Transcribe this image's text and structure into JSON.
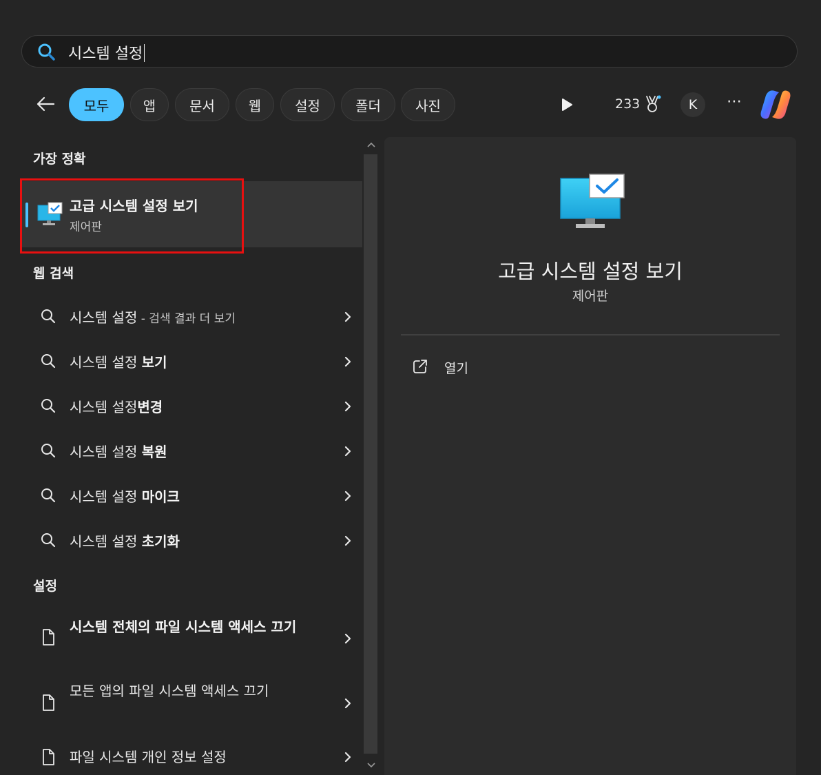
{
  "search": {
    "query": "시스템 설정"
  },
  "filters": [
    "모두",
    "앱",
    "문서",
    "웹",
    "설정",
    "폴더",
    "사진"
  ],
  "header": {
    "points": "233",
    "avatar_initial": "K"
  },
  "best_match": {
    "section_label": "가장 정확",
    "title": "고급 시스템 설정 보기",
    "subtitle": "제어판"
  },
  "web_search": {
    "section_label": "웹 검색",
    "items": [
      {
        "prefix": "시스템 설정",
        "bold": "",
        "suffix": " - 검색 결과 더 보기"
      },
      {
        "prefix": "시스템 설정 ",
        "bold": "보기",
        "suffix": ""
      },
      {
        "prefix": "시스템 설정",
        "bold": "변경",
        "suffix": ""
      },
      {
        "prefix": "시스템 설정 ",
        "bold": "복원",
        "suffix": ""
      },
      {
        "prefix": "시스템 설정 ",
        "bold": "마이크",
        "suffix": ""
      },
      {
        "prefix": "시스템 설정 ",
        "bold": "초기화",
        "suffix": ""
      }
    ]
  },
  "settings": {
    "section_label": "설정",
    "items": [
      {
        "text": "시스템 전체의 파일 시스템 액세스 끄기"
      },
      {
        "text": "모든 앱의 파일 시스템 액세스 끄기"
      },
      {
        "text": "파일 시스템 개인 정보 설정"
      }
    ]
  },
  "preview": {
    "title": "고급 시스템 설정 보기",
    "subtitle": "제어판",
    "actions": [
      {
        "label": "열기",
        "icon": "open-external-icon"
      }
    ]
  },
  "colors": {
    "accent": "#4cc2ff",
    "highlight_box": "#e81010",
    "background": "#252525"
  }
}
